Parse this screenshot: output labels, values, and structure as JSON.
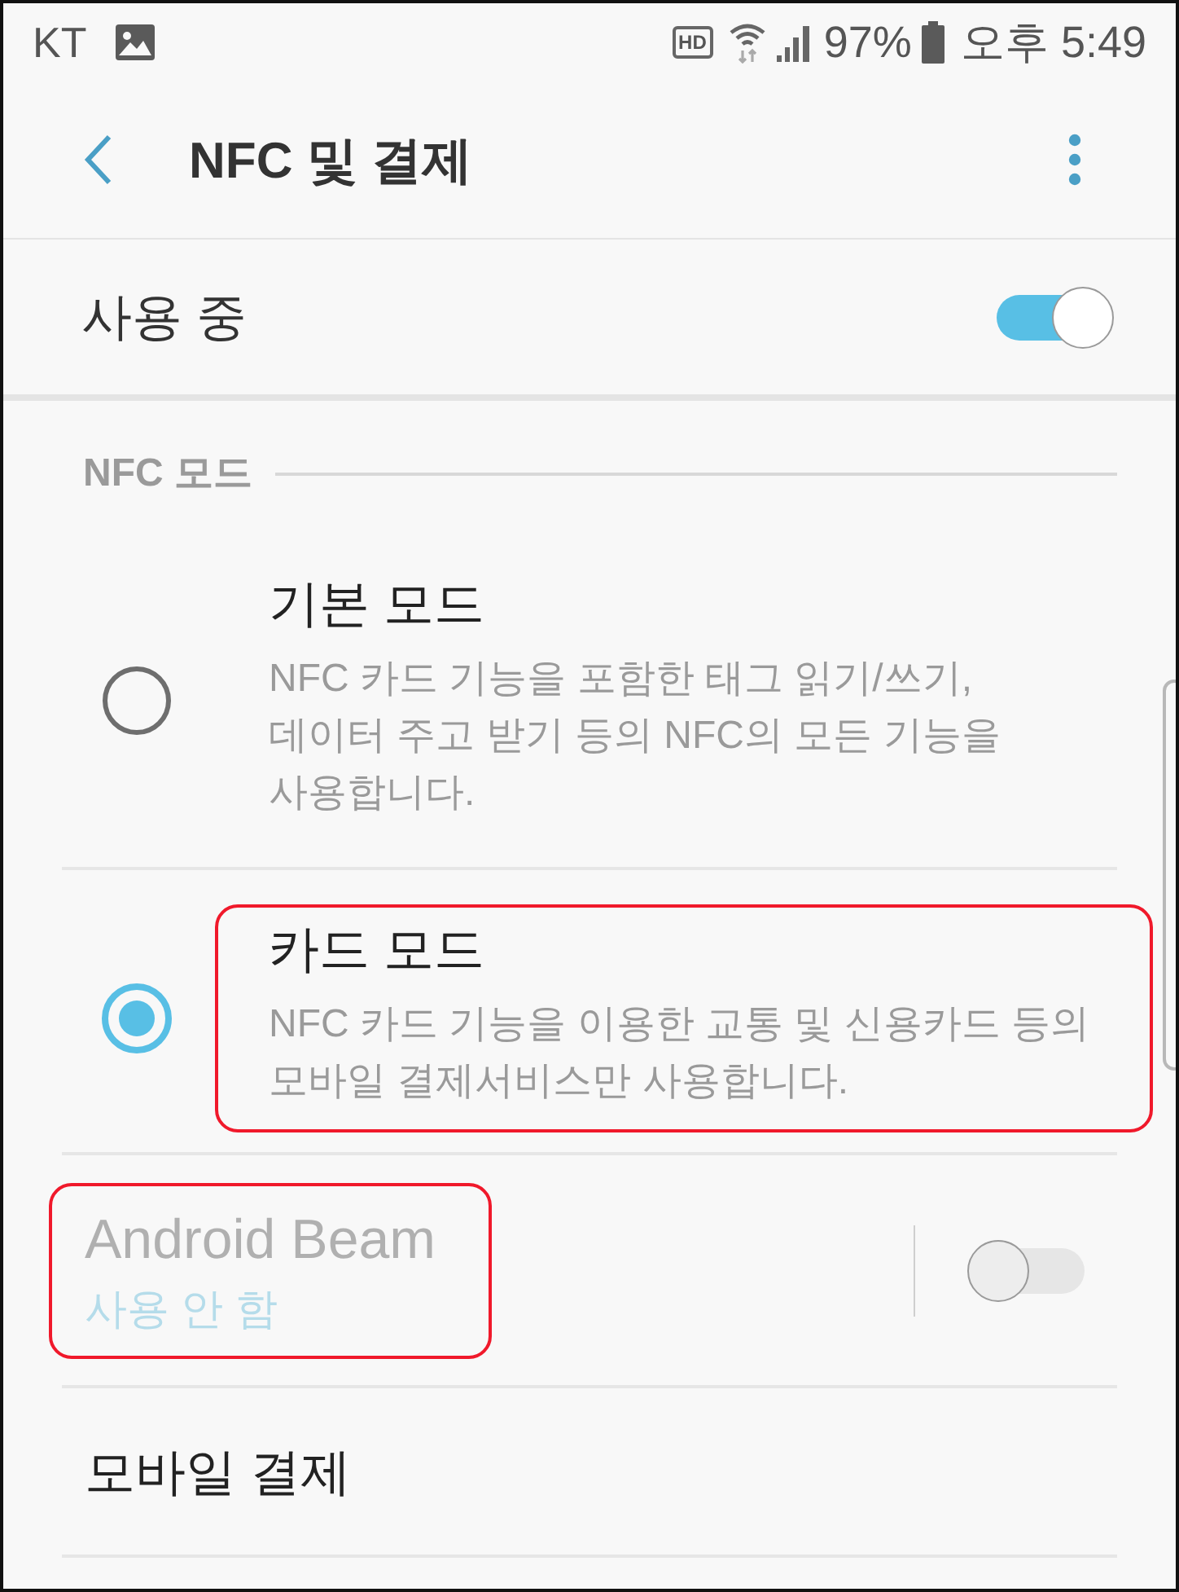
{
  "status_bar": {
    "carrier": "KT",
    "hd_badge": "HD",
    "battery_text": "97%",
    "time": "오후 5:49"
  },
  "app_bar": {
    "title": "NFC 및 결제"
  },
  "master_switch": {
    "label": "사용 중",
    "on": true
  },
  "section": {
    "title": "NFC 모드"
  },
  "modes": [
    {
      "title": "기본 모드",
      "description": "NFC 카드 기능을 포함한 태그 읽기/쓰기, 데이터 주고 받기 등의 NFC의 모든 기능을 사용합니다.",
      "selected": false,
      "highlighted": false
    },
    {
      "title": "카드 모드",
      "description": "NFC 카드 기능을 이용한 교통 및 신용카드 등의 모바일 결제서비스만 사용합니다.",
      "selected": true,
      "highlighted": true
    }
  ],
  "android_beam": {
    "title": "Android Beam",
    "status": "사용 안 함",
    "on": false,
    "disabled": true,
    "highlighted": true
  },
  "menu_items": [
    {
      "label": "모바일 결제"
    }
  ]
}
